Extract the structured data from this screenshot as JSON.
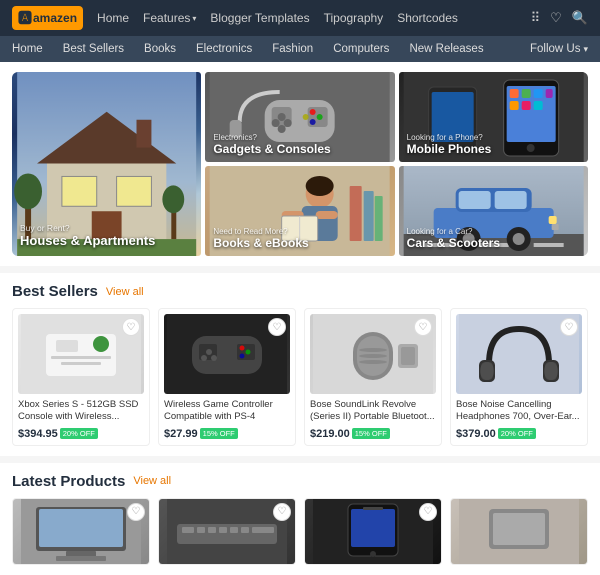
{
  "header": {
    "logo": "amazen",
    "nav_links": [
      {
        "label": "Home"
      },
      {
        "label": "Features",
        "has_dropdown": true
      },
      {
        "label": "Blogger Templates"
      },
      {
        "label": "Tipography"
      },
      {
        "label": "Shortcodes"
      }
    ],
    "icons": [
      "dots-grid",
      "heart",
      "search"
    ]
  },
  "second_nav": {
    "links": [
      {
        "label": "Home"
      },
      {
        "label": "Best Sellers"
      },
      {
        "label": "Books"
      },
      {
        "label": "Electronics"
      },
      {
        "label": "Fashion"
      },
      {
        "label": "Computers"
      },
      {
        "label": "New Releases"
      }
    ],
    "follow_us": "Follow Us"
  },
  "hero": {
    "items": [
      {
        "id": 1,
        "sub_label": "Buy or Rent?",
        "title": "Houses & Apartments",
        "bg": "house"
      },
      {
        "id": 2,
        "sub_label": "Electronics?",
        "title": "Gadgets & Consoles",
        "bg": "gadgets"
      },
      {
        "id": 3,
        "sub_label": "Looking for a Phone?",
        "title": "Mobile Phones",
        "bg": "phones"
      },
      {
        "id": 4,
        "sub_label": "Need to Read More?",
        "title": "Books & eBooks",
        "bg": "books"
      },
      {
        "id": 5,
        "sub_label": "Looking for a Car?",
        "title": "Cars & Scooters",
        "bg": "cars"
      }
    ]
  },
  "best_sellers": {
    "section_title": "Best Sellers",
    "view_all": "View all",
    "products": [
      {
        "id": 1,
        "title": "Xbox Series S - 512GB SSD Console with Wireless...",
        "price": "$394.95",
        "discount": "20% OFF",
        "img": "xbox"
      },
      {
        "id": 2,
        "title": "Wireless Game Controller Compatible with PS-4",
        "price": "$27.99",
        "discount": "15% OFF",
        "img": "controller"
      },
      {
        "id": 3,
        "title": "Bose SoundLink Revolve (Series II) Portable Bluetoot...",
        "price": "$219.00",
        "discount": "15% OFF",
        "img": "speaker"
      },
      {
        "id": 4,
        "title": "Bose Noise Cancelling Headphones 700, Over-Ear...",
        "price": "$379.00",
        "discount": "20% OFF",
        "img": "headphones"
      }
    ]
  },
  "latest_products": {
    "section_title": "Latest Products",
    "view_all": "View all",
    "products": [
      {
        "id": 1,
        "img": "monitor"
      },
      {
        "id": 2,
        "img": "keyboard"
      },
      {
        "id": 3,
        "img": "mobile"
      }
    ]
  }
}
